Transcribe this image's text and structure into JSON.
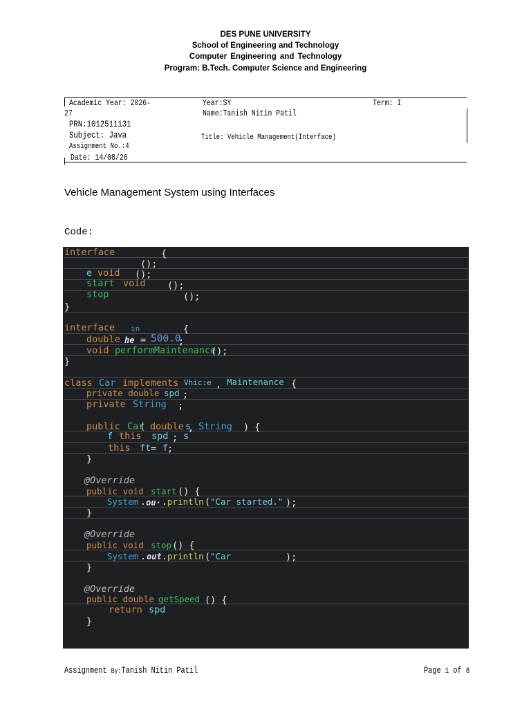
{
  "header": {
    "university": "DES PUNE UNIVERSITY",
    "school": "School of Engineering and Technology",
    "department": "Computer  Engineering  and  Technology",
    "program": "Program: B.Tech. Computer Science and Engineering"
  },
  "info": {
    "academic_year_label": "Academic Year: 2026-",
    "academic_year_cont": "27",
    "year": "Year:SY",
    "term": "Term: I",
    "name": "Name:Tanish  Nitin Patil",
    "prn": "PRN:1012511131",
    "subject": "Subject: Java",
    "title": "Title:   Vehicle    Management(Interface)",
    "assignment_no": "Assignment No.:4",
    "date": "Date: 14/08/26"
  },
  "doc_title": "Vehicle Management System using Interfaces",
  "code_label": "Code:",
  "code": {
    "l1_kw": "interface",
    "l1_b": "{",
    "l2": "();",
    "l3_a": "e",
    "l3_b": "void",
    "l3_c": "();",
    "l4_a": "start",
    "l4_b": "void",
    "l4_c": "();",
    "l5_a": "stop",
    "l5_b": "();",
    "l6": "}",
    "l8_kw": "interface",
    "l8_in": "in",
    "l8_b": "{",
    "l9_a": "double",
    "l9_he": "he",
    "l9_eq": "=",
    "l9_num": "500.0",
    "l9_semi": ";",
    "l10_a": "void",
    "l10_b": "performMaintenance",
    "l10_c": "();",
    "l11": "}",
    "l13_a": "class",
    "l13_b": "Car",
    "l13_c": "implements",
    "l13_d": "Vhic:e",
    "l13_e": ",",
    "l13_f": "Maintenance",
    "l13_g": "{",
    "l14_a": "private double",
    "l14_b": "spd",
    "l14_c": ";",
    "l15_a": "private",
    "l15_b": "String",
    "l15_c": ";",
    "l17_a": "public",
    "l17_b": "Car",
    "l17_c": "(",
    "l17_d": "double",
    "l17_e": "s",
    "l17_f": ",",
    "l17_g": "String",
    "l17_h": ") {",
    "l18_a": "f",
    "l18_b": "this",
    "l18_c": "spd",
    "l18_d": ";",
    "l18_e": "s",
    "l19_a": "this",
    "l19_b": "ft",
    "l19_c": "=",
    "l19_d": "f",
    "l19_e": ";",
    "l20": "}",
    "l22": "@Override",
    "l23_a": "public void",
    "l23_b": "start",
    "l23_c": "() {",
    "l24_a": "System",
    "l24_b": ".",
    "l24_c": "ou·",
    "l24_d": ".",
    "l24_e": "println",
    "l24_f": "(",
    "l24_g": "\"Car started.\"",
    "l24_h": ");",
    "l25": "}",
    "l27": "@Override",
    "l28_a": "public void",
    "l28_b": "stop",
    "l28_c": "() {",
    "l29_a": "System",
    "l29_b": ".",
    "l29_c": "out",
    "l29_d": ".",
    "l29_e": "println",
    "l29_f": "(",
    "l29_g": "\"Car",
    "l29_h": ");",
    "l30": "}",
    "l32": "@Override",
    "l33_a": "public double",
    "l33_b": "getSpeed",
    "l33_c": "() {",
    "l34_a": "return",
    "l34_b": "spd",
    "l35": "}"
  },
  "footer": {
    "assignment": "Assignment",
    "by": "By:",
    "author": "Tanish  Nitin Patil",
    "page": "Page",
    "page_num": "1",
    "of": "of",
    "total": "8"
  },
  "colors": {
    "code_background": "#1e1f22",
    "keyword": "#cf8e4a",
    "method": "#3fbf5a",
    "type": "#3ba4d9"
  }
}
